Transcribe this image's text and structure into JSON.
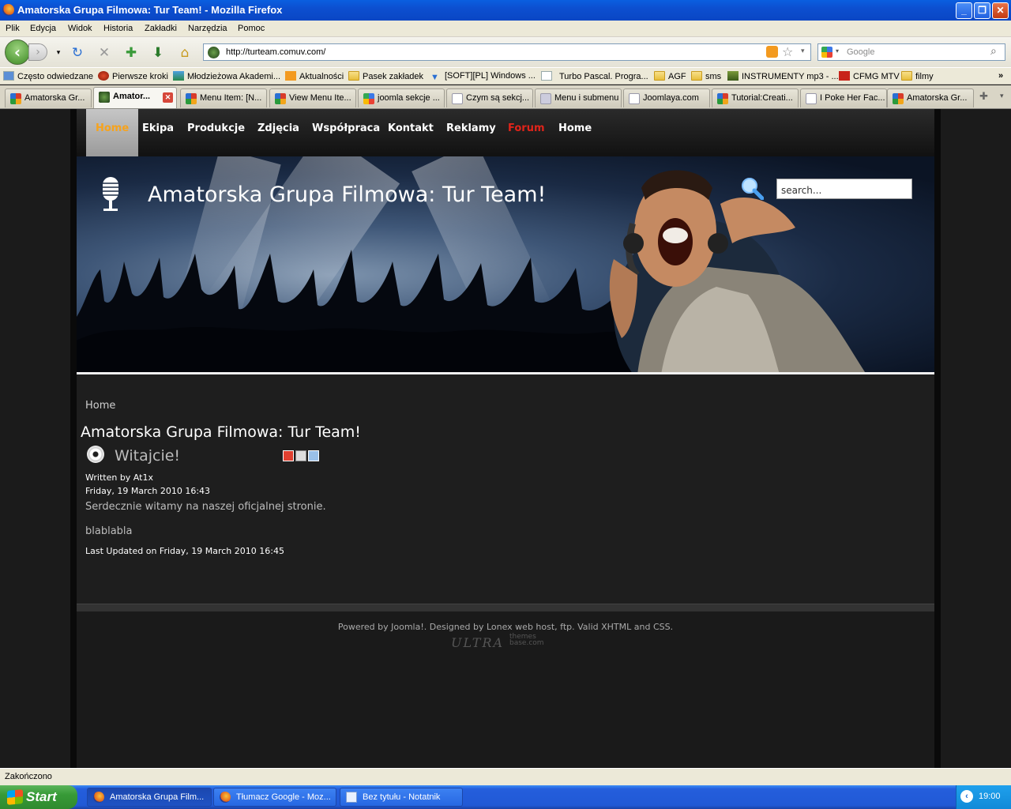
{
  "window": {
    "title": "Amatorska Grupa Filmowa: Tur Team! - Mozilla Firefox"
  },
  "menubar": [
    "Plik",
    "Edycja",
    "Widok",
    "Historia",
    "Zakładki",
    "Narzędzia",
    "Pomoc"
  ],
  "urlbar": {
    "url": "http://turteam.comuv.com/"
  },
  "searchbar": {
    "placeholder": "Google"
  },
  "bookmarks": [
    "Często odwiedzane",
    "Pierwsze kroki",
    "Młodzieżowa Akademi...",
    "Aktualności",
    "Pasek zakładek",
    "[SOFT][PL] Windows ...",
    "Turbo Pascal. Progra...",
    "AGF",
    "sms",
    "INSTRUMENTY mp3 - ...",
    "CFMG MTV",
    "filmy"
  ],
  "bookmarks_more": "»",
  "tabs": [
    "Amatorska Gr...",
    "Amator...",
    "Menu Item: [N...",
    "View Menu Ite...",
    "joomla sekcje ...",
    "Czym są sekcj...",
    "Menu i submenu",
    "Joomlaya.com",
    "Tutorial:Creati...",
    "I Poke Her Fac...",
    "Amatorska Gr..."
  ],
  "site": {
    "nav": [
      "Home",
      "Ekipa",
      "Produkcje",
      "Zdjęcia",
      "Współpraca",
      "Kontakt",
      "Reklamy",
      "Forum",
      "Home"
    ],
    "title": "Amatorska Grupa Filmowa: Tur Team!",
    "search_value": "search...",
    "breadcrumb": "Home",
    "page_heading": "Amatorska Grupa Filmowa: Tur Team!",
    "article": {
      "title": "Witajcie!",
      "author": "Written by At1x",
      "date": "Friday, 19 March 2010 16:43",
      "intro": "Serdecznie witamy na naszej oficjalnej stronie.",
      "body": "blablabla",
      "updated": "Last Updated on Friday, 19 March 2010 16:45"
    },
    "footer": "Powered by Joomla!. Designed by Lonex web host, ftp. Valid XHTML and CSS.",
    "footer_logo_left": "ULTRA",
    "footer_logo_right_1": "themes",
    "footer_logo_right_2": "base.com"
  },
  "status": "Zakończono",
  "taskbar": {
    "start": "Start",
    "tasks": [
      "Amatorska Grupa Film...",
      "Tłumacz Google - Moz...",
      "Bez tytułu - Notatnik"
    ],
    "clock": "19:00"
  },
  "colors": {
    "nav_active": "#f7a31c",
    "forum": "#e0241a",
    "titlebar": "#0a5fe0"
  }
}
